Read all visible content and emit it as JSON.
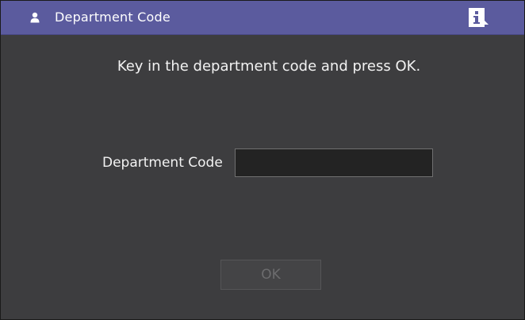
{
  "window": {
    "title": "Department Code",
    "title_icon": "user-icon",
    "info_icon": "info-icon"
  },
  "main": {
    "prompt": "Key in the department code and press OK.",
    "field_label": "Department Code",
    "field_value": "",
    "ok_label": "OK",
    "ok_enabled": false
  },
  "colors": {
    "titlebar": "#5b5b9e",
    "background": "#3d3d3f",
    "input_background": "#232323",
    "disabled_text": "#6c6c6e"
  }
}
